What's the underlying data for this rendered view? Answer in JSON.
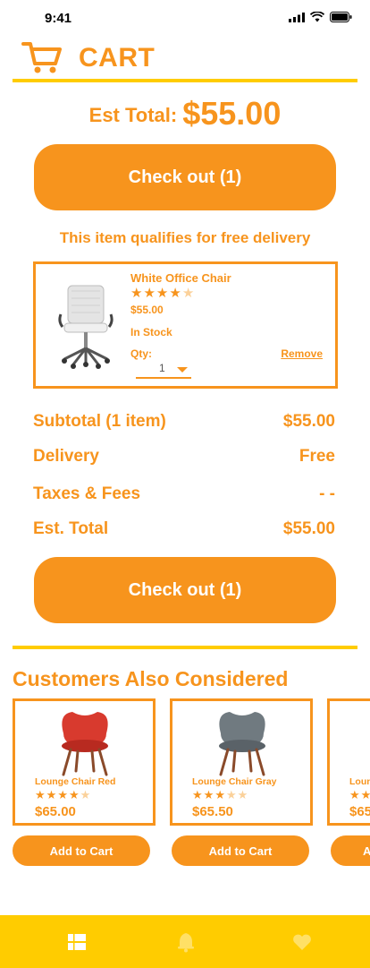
{
  "status": {
    "time": "9:41"
  },
  "header": {
    "title": "CART"
  },
  "summary_top": {
    "label": "Est Total:",
    "value": "$55.00"
  },
  "checkout": {
    "label": "Check out (1)"
  },
  "free_delivery": "This item qualifies for free delivery",
  "cart_item": {
    "name": "White Office Chair",
    "rating": 4.5,
    "rating_max": 5,
    "price": "$55.00",
    "stock": "In Stock",
    "qty_label": "Qty:",
    "qty_value": "1",
    "remove_label": "Remove"
  },
  "order_summary": [
    {
      "label": "Subtotal (1 item)",
      "value": "$55.00"
    },
    {
      "label": "Delivery",
      "value": "Free"
    },
    {
      "label": "Taxes & Fees",
      "value": "- -"
    },
    {
      "label": "Est. Total",
      "value": "$55.00"
    }
  ],
  "recommendations": {
    "title": "Customers Also Considered",
    "items": [
      {
        "name": "Lounge Chair Red",
        "rating": 4.5,
        "price": "$65.00",
        "button": "Add to Cart",
        "color": "#d83a2e"
      },
      {
        "name": "Lounge Chair Gray",
        "rating": 3.5,
        "price": "$65.50",
        "button": "Add to Cart",
        "color": "#707a80"
      },
      {
        "name": "Loun",
        "rating": 4.5,
        "price": "$65",
        "button": "A",
        "color": "#f7941d"
      }
    ]
  },
  "colors": {
    "accent": "#f7941d",
    "highlight": "#ffcc00",
    "star_empty": "#fbd19a"
  },
  "icons": {
    "header": "cart-icon",
    "nav": [
      "list-icon",
      "bell-icon",
      "heart-icon"
    ]
  }
}
